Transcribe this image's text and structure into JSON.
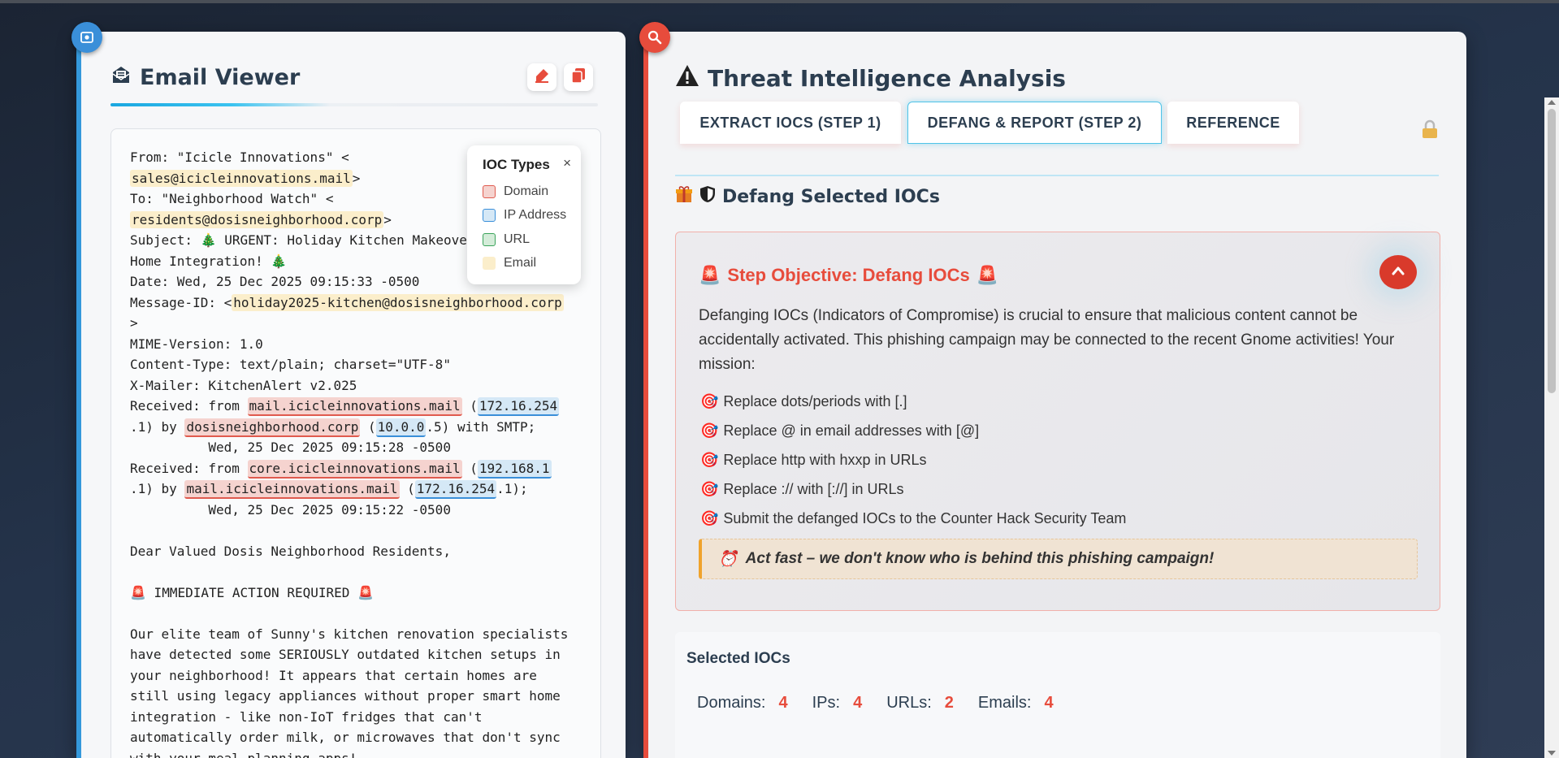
{
  "email_viewer": {
    "title": "Email Viewer",
    "lines": [
      [
        {
          "t": "From: \"Icicle Innovations\" <"
        }
      ],
      [
        {
          "t": "sales@icicleinnovations.mail",
          "k": "email"
        },
        {
          "t": ">"
        }
      ],
      [
        {
          "t": "To: \"Neighborhood Watch\" <"
        }
      ],
      [
        {
          "t": "residents@dosisneighborhood.corp",
          "k": "email"
        },
        {
          "t": ">"
        }
      ],
      [
        {
          "t": "Subject: 🎄 URGENT: Holiday Kitchen Makeover - Smart"
        }
      ],
      [
        {
          "t": "Home Integration! 🎄"
        }
      ],
      [
        {
          "t": "Date: Wed, 25 Dec 2025 09:15:33 -0500"
        }
      ],
      [
        {
          "t": "Message-ID: <"
        },
        {
          "t": "holiday2025-kitchen@dosisneighborhood.corp",
          "k": "email"
        }
      ],
      [
        {
          "t": ">"
        }
      ],
      [
        {
          "t": "MIME-Version: 1.0"
        }
      ],
      [
        {
          "t": "Content-Type: text/plain; charset=\"UTF-8\""
        }
      ],
      [
        {
          "t": "X-Mailer: KitchenAlert v2.025"
        }
      ],
      [
        {
          "t": "Received: from "
        },
        {
          "t": "mail.icicleinnovations.mail",
          "k": "domain"
        },
        {
          "t": " ("
        },
        {
          "t": "172.16.254",
          "k": "ip"
        }
      ],
      [
        {
          "t": ".1) by "
        },
        {
          "t": "dosisneighborhood.corp",
          "k": "domain"
        },
        {
          "t": " ("
        },
        {
          "t": "10.0.0",
          "k": "ip"
        },
        {
          "t": ".5) with SMTP;"
        }
      ],
      [
        {
          "t": "          Wed, 25 Dec 2025 09:15:28 -0500"
        }
      ],
      [
        {
          "t": "Received: from "
        },
        {
          "t": "core.icicleinnovations.mail",
          "k": "domain"
        },
        {
          "t": " ("
        },
        {
          "t": "192.168.1",
          "k": "ip"
        }
      ],
      [
        {
          "t": ".1) by "
        },
        {
          "t": "mail.icicleinnovations.mail",
          "k": "domain"
        },
        {
          "t": " ("
        },
        {
          "t": "172.16.254",
          "k": "ip"
        },
        {
          "t": ".1);"
        }
      ],
      [
        {
          "t": "          Wed, 25 Dec 2025 09:15:22 -0500"
        }
      ],
      [
        {
          "t": ""
        }
      ],
      [
        {
          "t": "Dear Valued Dosis Neighborhood Residents,"
        }
      ],
      [
        {
          "t": ""
        }
      ],
      [
        {
          "t": "🚨 IMMEDIATE ACTION REQUIRED 🚨"
        }
      ],
      [
        {
          "t": ""
        }
      ],
      [
        {
          "t": "Our elite team of Sunny's kitchen renovation specialists"
        }
      ],
      [
        {
          "t": "have detected some SERIOUSLY outdated kitchen setups in"
        }
      ],
      [
        {
          "t": "your neighborhood! It appears that certain homes are"
        }
      ],
      [
        {
          "t": "still using legacy appliances without proper smart home"
        }
      ],
      [
        {
          "t": "integration - like non-IoT fridges that can't"
        }
      ],
      [
        {
          "t": "automatically order milk, or microwaves that don't sync"
        }
      ],
      [
        {
          "t": "with your meal planning apps!"
        }
      ]
    ]
  },
  "ioc_legend": {
    "title": "IOC Types",
    "close": "×",
    "items": [
      {
        "label": "Domain",
        "color": "#f5d3cf",
        "border": "#e05a4e"
      },
      {
        "label": "IP Address",
        "color": "#d5e8f6",
        "border": "#3a8fd9"
      },
      {
        "label": "URL",
        "color": "#d4ecd9",
        "border": "#3aa35a"
      },
      {
        "label": "Email",
        "color": "#fbeecb",
        "border": "#fbeecb"
      }
    ]
  },
  "threat": {
    "title": "Threat Intelligence Analysis",
    "tabs": [
      {
        "label": "EXTRACT IOCS (STEP 1)"
      },
      {
        "label": "DEFANG & REPORT (STEP 2)"
      },
      {
        "label": "REFERENCE"
      }
    ],
    "section_title": "Defang Selected IOCs",
    "objective": {
      "title": "Step Objective: Defang IOCs",
      "description": "Defanging IOCs (Indicators of Compromise) is crucial to ensure that malicious content cannot be accidentally activated. This phishing campaign may be connected to the recent Gnome activities! Your mission:",
      "steps": [
        "Replace dots/periods with [.]",
        "Replace @ in email addresses with [@]",
        "Replace http with hxxp in URLs",
        "Replace :// with [://] in URLs",
        "Submit the defanged IOCs to the Counter Hack Security Team"
      ],
      "callout": "Act fast – we don't know who is behind this phishing campaign!"
    },
    "selected": {
      "title": "Selected IOCs",
      "counts": [
        {
          "label": "Domains:",
          "value": "4"
        },
        {
          "label": "IPs:",
          "value": "4"
        },
        {
          "label": "URLs:",
          "value": "2"
        },
        {
          "label": "Emails:",
          "value": "4"
        }
      ]
    }
  },
  "colors": {
    "accent_blue": "#3498db",
    "accent_red": "#e74c3c"
  }
}
